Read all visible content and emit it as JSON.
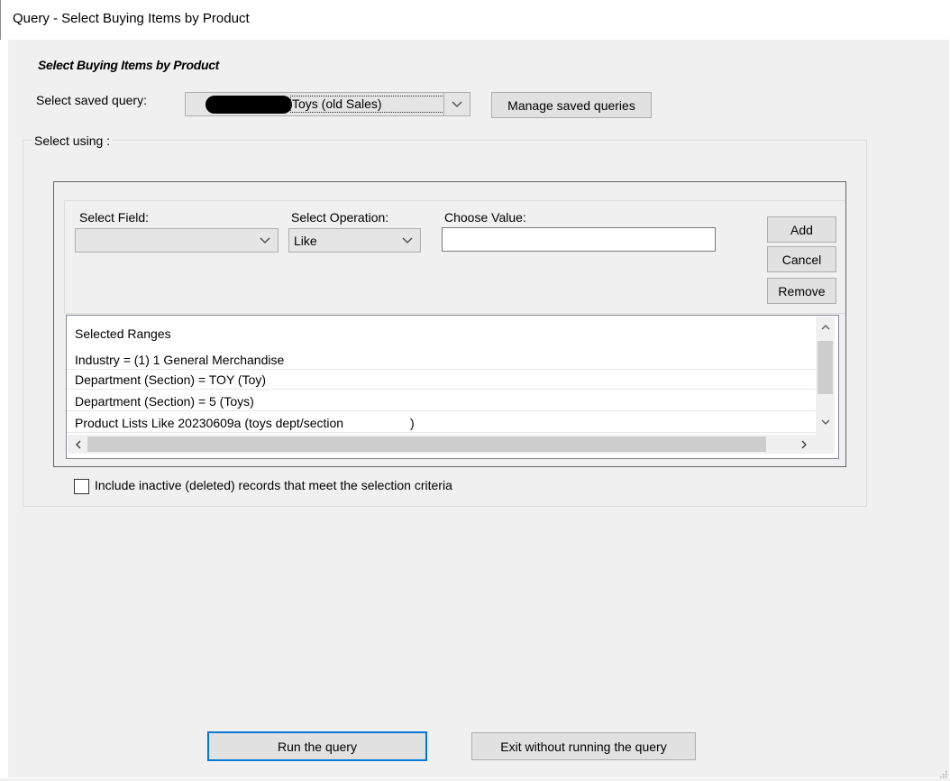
{
  "window": {
    "title": "Query - Select Buying Items by Product"
  },
  "form": {
    "heading": "Select Buying Items by Product",
    "saved_query_label": "Select saved query:",
    "saved_query_value": "Toys (old Sales)",
    "manage_button": "Manage saved queries",
    "select_using_label": "Select using :"
  },
  "criteria": {
    "field_label": "Select Field:",
    "field_value": "",
    "operation_label": "Select Operation:",
    "operation_value": "Like",
    "value_label": "Choose Value:",
    "value_input": "",
    "add_button": "Add",
    "cancel_button": "Cancel",
    "remove_button": "Remove"
  },
  "ranges": {
    "header": "Selected Ranges",
    "items": [
      "Industry = (1) 1 General Merchandise",
      "Department (Section) = TOY (Toy)",
      "Department (Section) = 5 (Toys)",
      "Product Lists Like 20230609a (toys dept/section                   )"
    ]
  },
  "include_inactive": {
    "label": "Include inactive (deleted) records that meet the selection criteria",
    "checked": false
  },
  "footer": {
    "run_button": "Run the query",
    "exit_button": "Exit without running the query"
  },
  "icons": [
    "chevron-down-icon",
    "chevron-up-icon",
    "chevron-left-icon",
    "chevron-right-icon",
    "resize-grip-icon"
  ]
}
